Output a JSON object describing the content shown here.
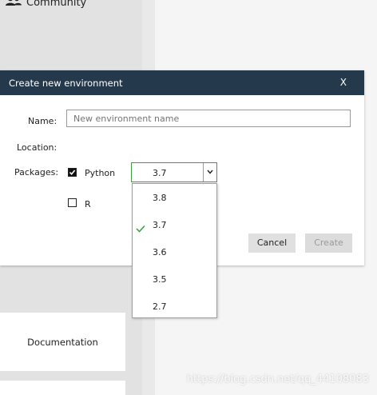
{
  "sidebar": {
    "community_label": "Community",
    "documentation_label": "Documentation"
  },
  "dialog": {
    "title": "Create new environment",
    "close_label": "X",
    "name_label": "Name:",
    "name_placeholder": "New environment name",
    "location_label": "Location:",
    "packages_label": "Packages:",
    "packages": [
      {
        "label": "Python",
        "checked": true
      },
      {
        "label": "R",
        "checked": false
      }
    ],
    "python_version": {
      "selected": "3.7",
      "options": [
        "3.8",
        "3.7",
        "3.6",
        "3.5",
        "2.7"
      ]
    },
    "cancel_label": "Cancel",
    "create_label": "Create"
  },
  "colors": {
    "header_bg": "#243a4c",
    "accent_green": "#3f9b3f"
  },
  "watermark": "https://blog.csdn.net/qq_44108083"
}
